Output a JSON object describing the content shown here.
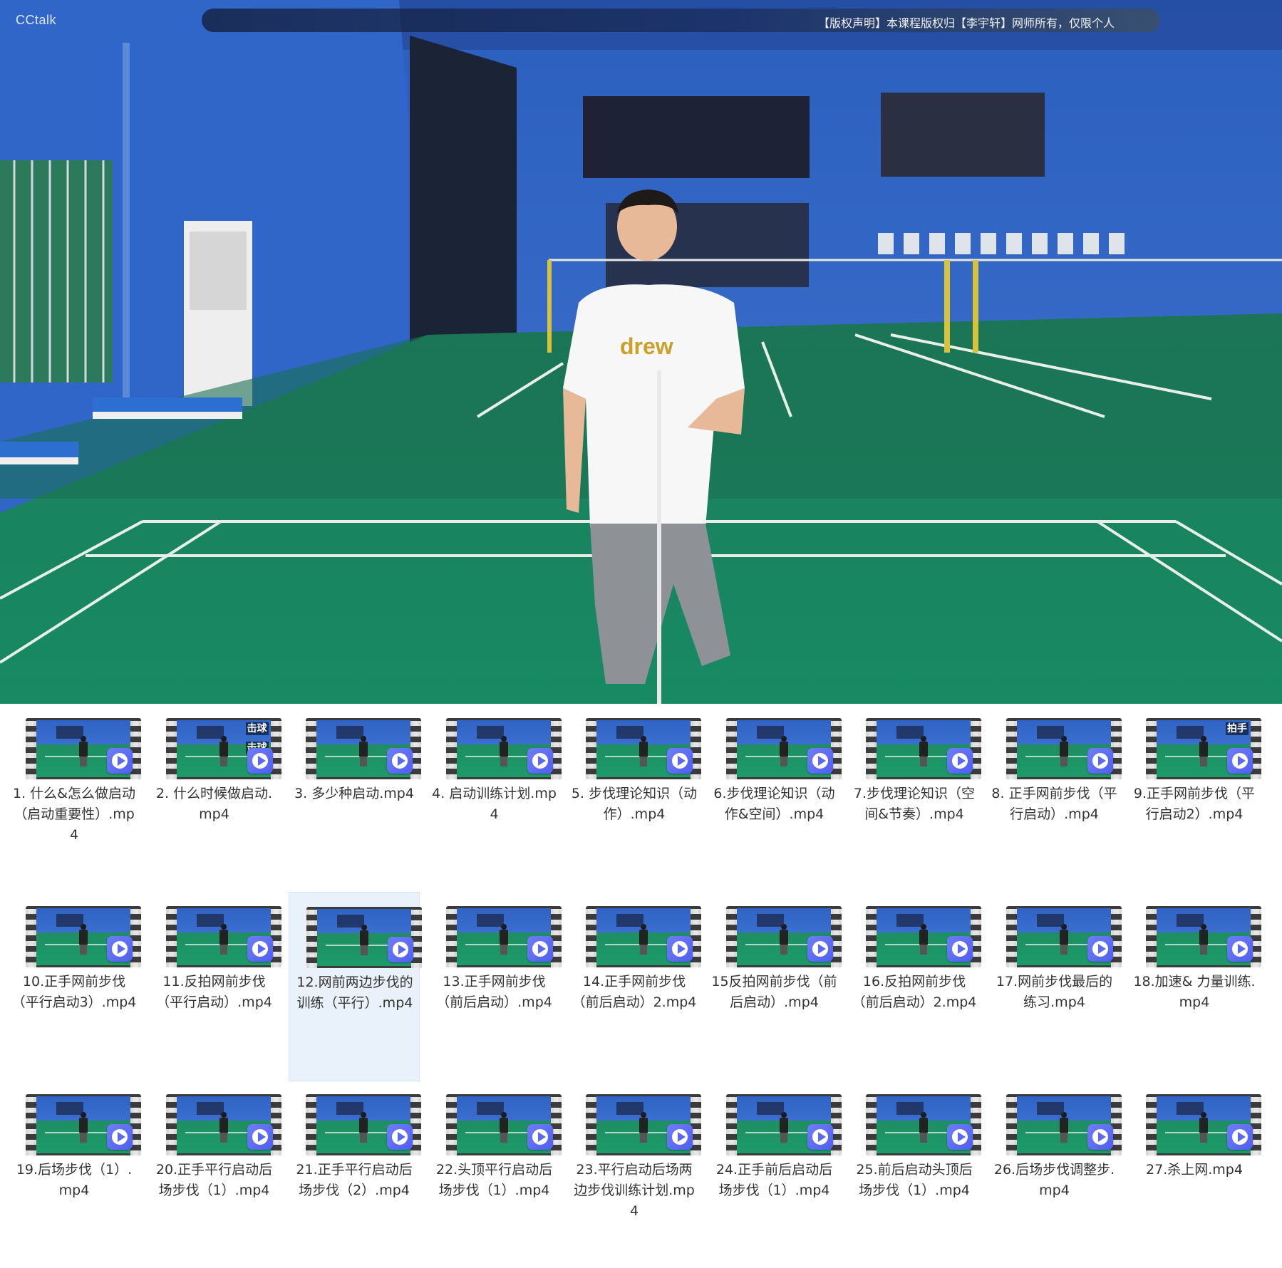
{
  "player": {
    "watermark": "CCtalk",
    "notice": "【版权声明】本课程版权归【李宇轩】网师所有，仅限个人",
    "shirt_text": "drew"
  },
  "files": [
    {
      "name": "1. 什么&怎么做启动（启动重要性）.mp4",
      "overlay": []
    },
    {
      "name": "2. 什么时候做启动.mp4",
      "overlay": [
        "击球",
        "击球",
        "击"
      ]
    },
    {
      "name": "3. 多少种启动.mp4",
      "overlay": []
    },
    {
      "name": "4. 启动训练计划.mp4",
      "overlay": []
    },
    {
      "name": "5. 步伐理论知识（动作）.mp4",
      "overlay": []
    },
    {
      "name": "6.步伐理论知识（动作&空间）.mp4",
      "overlay": []
    },
    {
      "name": "7.步伐理论知识（空间&节奏）.mp4",
      "overlay": []
    },
    {
      "name": "8. 正手网前步伐（平行启动）.mp4",
      "overlay": []
    },
    {
      "name": "9.正手网前步伐（平行启动2）.mp4",
      "overlay": [
        "拍手"
      ]
    },
    {
      "name": "10.正手网前步伐（平行启动3）.mp4",
      "overlay": []
    },
    {
      "name": "11.反拍网前步伐（平行启动）.mp4",
      "overlay": []
    },
    {
      "name": "12.网前两边步伐的训练（平行）.mp4",
      "overlay": []
    },
    {
      "name": "13.正手网前步伐（前后启动）.mp4",
      "overlay": []
    },
    {
      "name": "14.正手网前步伐（前后启动）2.mp4",
      "overlay": []
    },
    {
      "name": "15反拍网前步伐（前后启动）.mp4",
      "overlay": []
    },
    {
      "name": "16.反拍网前步伐（前后启动）2.mp4",
      "overlay": []
    },
    {
      "name": "17.网前步伐最后的练习.mp4",
      "overlay": []
    },
    {
      "name": "18.加速& 力量训练.mp4",
      "overlay": []
    },
    {
      "name": "19.后场步伐（1）.mp4",
      "overlay": []
    },
    {
      "name": "20.正手平行启动后场步伐（1）.mp4",
      "overlay": []
    },
    {
      "name": "21.正手平行启动后场步伐（2）.mp4",
      "overlay": []
    },
    {
      "name": "22.头顶平行启动后场步伐（1）.mp4",
      "overlay": []
    },
    {
      "name": "23.平行启动后场两边步伐训练计划.mp4",
      "overlay": []
    },
    {
      "name": "24.正手前后启动后场步伐（1）.mp4",
      "overlay": []
    },
    {
      "name": "25.前后启动头顶后场步伐（1）.mp4",
      "overlay": []
    },
    {
      "name": "26.后场步伐调整步.mp4",
      "overlay": []
    },
    {
      "name": "27.杀上网.mp4",
      "overlay": []
    }
  ],
  "selected_index": 11,
  "icon": "video-file-icon"
}
